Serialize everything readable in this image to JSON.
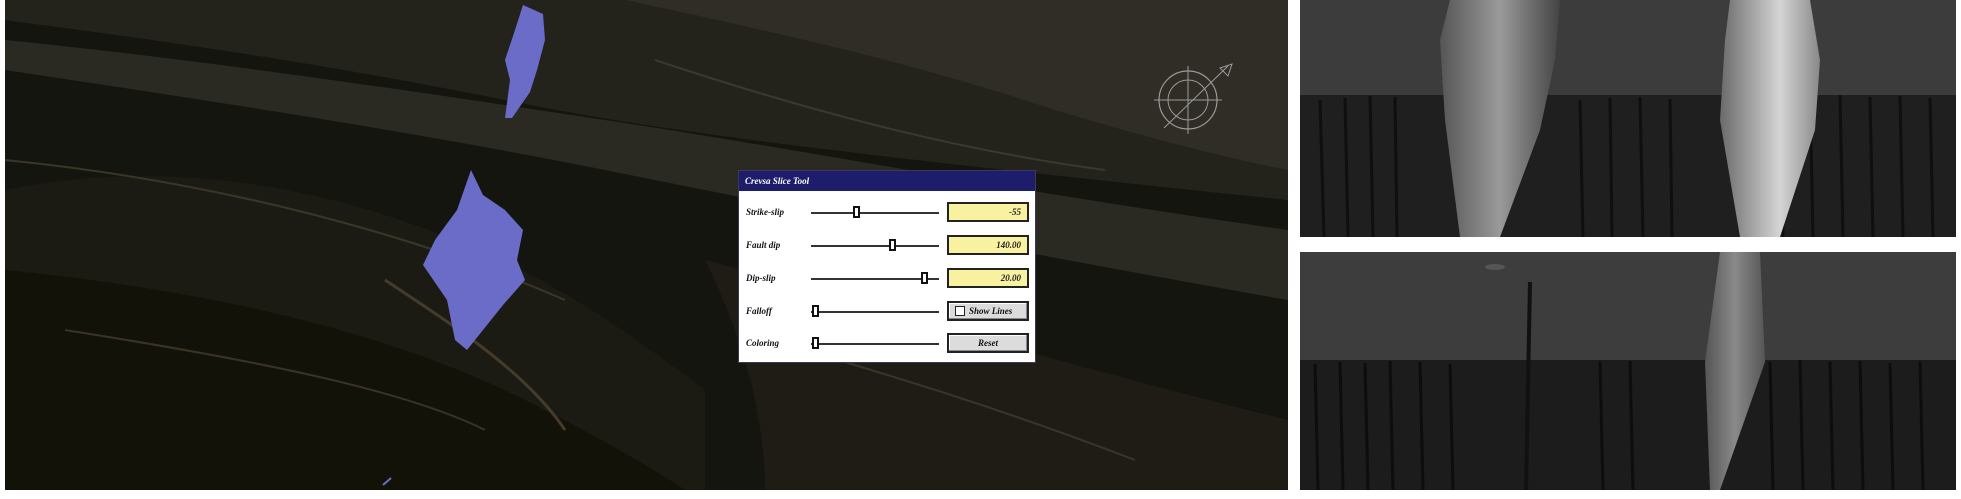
{
  "dialog": {
    "title": "Crevsa Slice Tool",
    "sliders": [
      {
        "label": "Strike-slip",
        "position": 0.35,
        "value": "-55"
      },
      {
        "label": "Fault dip",
        "position": 0.63,
        "value": "140.00"
      },
      {
        "label": "Dip-slip",
        "position": 0.88,
        "value": "20.00"
      },
      {
        "label": "Falloff",
        "position": 0.03
      },
      {
        "label": "Coloring",
        "position": 0.03
      }
    ],
    "show_lines_label": "Show Lines",
    "reset_label": "Reset"
  },
  "colors": {
    "fault_plane": "#6b6bc8",
    "titlebar": "#1d1d6b",
    "value_field": "#f7f1a0"
  },
  "icons": [
    "compass-icon",
    "checkbox-icon"
  ]
}
